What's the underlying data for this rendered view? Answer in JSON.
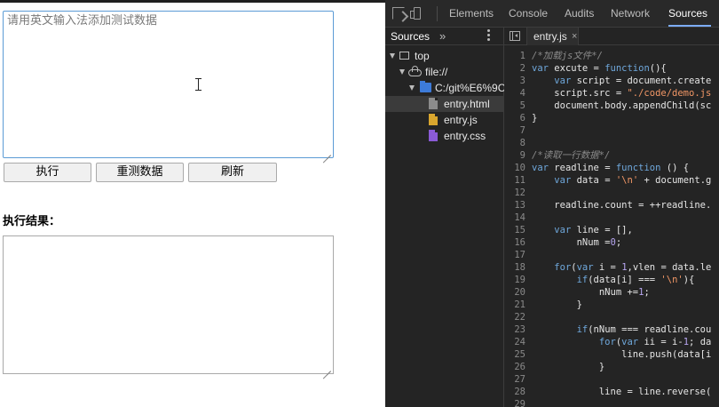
{
  "page": {
    "textarea_placeholder": "请用英文输入法添加测试数据",
    "buttons": {
      "execute": "执行",
      "retest": "重测数据",
      "refresh": "刷新"
    },
    "result_label": "执行结果："
  },
  "devtools": {
    "tabs": [
      "Elements",
      "Console",
      "Audits",
      "Network",
      "Sources"
    ],
    "active_tab": "Sources",
    "navigator": {
      "subtab": "Sources",
      "more": "»",
      "tree": {
        "top": "top",
        "origin": "file://",
        "folder": "C:/git%E6%9C",
        "files": [
          "entry.html",
          "entry.js",
          "entry.css"
        ]
      }
    },
    "editor": {
      "open_file": "entry.js",
      "close_glyph": "×",
      "line_numbers": [
        "1",
        "2",
        "3",
        "4",
        "5",
        "6",
        "7",
        "8",
        "9",
        "10",
        "11",
        "12",
        "13",
        "14",
        "15",
        "16",
        "17",
        "18",
        "19",
        "20",
        "21",
        "22",
        "23",
        "24",
        "25",
        "26",
        "27",
        "28",
        "29"
      ],
      "lines": [
        [
          [
            "c-com",
            "/*加载js文件*/"
          ]
        ],
        [
          [
            "c-kw",
            "var "
          ],
          [
            "c-fn",
            "excute = "
          ],
          [
            "c-kw",
            "function"
          ],
          [
            "",
            "(){"
          ]
        ],
        [
          [
            "",
            "    "
          ],
          [
            "c-kw",
            "var "
          ],
          [
            "",
            "script = document.create"
          ]
        ],
        [
          [
            "",
            "    script.src = "
          ],
          [
            "c-str",
            "\"./code/demo.js"
          ]
        ],
        [
          [
            "",
            "    document.body.appendChild(sc"
          ]
        ],
        [
          [
            "",
            "}"
          ]
        ],
        [
          [
            "",
            ""
          ]
        ],
        [
          [
            "",
            ""
          ]
        ],
        [
          [
            "c-com",
            "/*读取一行数据*/"
          ]
        ],
        [
          [
            "c-kw",
            "var "
          ],
          [
            "",
            "readline = "
          ],
          [
            "c-kw",
            "function "
          ],
          [
            "",
            "() {"
          ]
        ],
        [
          [
            "",
            "    "
          ],
          [
            "c-kw",
            "var "
          ],
          [
            "",
            "data = "
          ],
          [
            "c-str",
            "'\\n'"
          ],
          [
            "",
            " + document.g"
          ]
        ],
        [
          [
            "",
            ""
          ]
        ],
        [
          [
            "",
            "    readline.count = ++readline."
          ]
        ],
        [
          [
            "",
            ""
          ]
        ],
        [
          [
            "",
            "    "
          ],
          [
            "c-kw",
            "var "
          ],
          [
            "",
            "line = [],"
          ]
        ],
        [
          [
            "",
            "        nNum ="
          ],
          [
            "c-num",
            "0"
          ],
          [
            "",
            ";"
          ]
        ],
        [
          [
            "",
            ""
          ]
        ],
        [
          [
            "",
            "    "
          ],
          [
            "c-kw",
            "for"
          ],
          [
            "",
            "("
          ],
          [
            "c-kw",
            "var "
          ],
          [
            "",
            "i = "
          ],
          [
            "c-num",
            "1"
          ],
          [
            "",
            ",vlen = data.le"
          ]
        ],
        [
          [
            "",
            "        "
          ],
          [
            "c-kw",
            "if"
          ],
          [
            "",
            "(data[i] === "
          ],
          [
            "c-str",
            "'\\n'"
          ],
          [
            "",
            "){"
          ]
        ],
        [
          [
            "",
            "            nNum +="
          ],
          [
            "c-num",
            "1"
          ],
          [
            "",
            ";"
          ]
        ],
        [
          [
            "",
            "        }"
          ]
        ],
        [
          [
            "",
            ""
          ]
        ],
        [
          [
            "",
            "        "
          ],
          [
            "c-kw",
            "if"
          ],
          [
            "",
            "(nNum === readline.cou"
          ]
        ],
        [
          [
            "",
            "            "
          ],
          [
            "c-kw",
            "for"
          ],
          [
            "",
            "("
          ],
          [
            "c-kw",
            "var "
          ],
          [
            "",
            "ii = i-"
          ],
          [
            "c-num",
            "1"
          ],
          [
            "",
            "; da"
          ]
        ],
        [
          [
            "",
            "                line.push(data[i"
          ]
        ],
        [
          [
            "",
            "            }"
          ]
        ],
        [
          [
            "",
            ""
          ]
        ],
        [
          [
            "",
            "            line = line.reverse("
          ]
        ],
        [
          [
            "",
            ""
          ]
        ]
      ]
    }
  }
}
